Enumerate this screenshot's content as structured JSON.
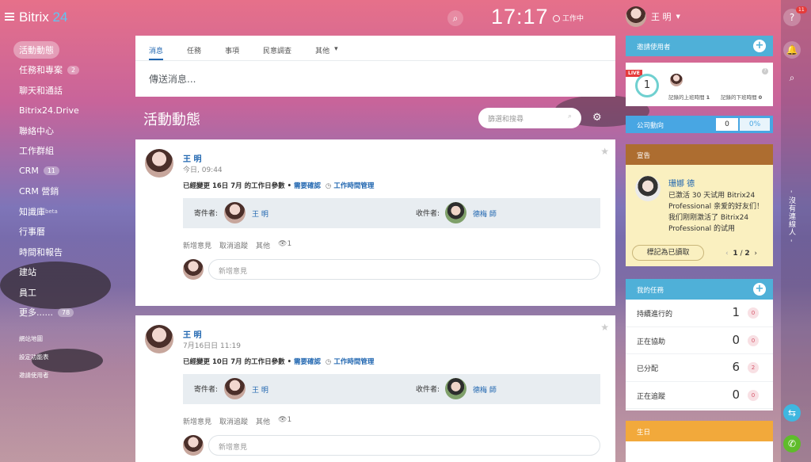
{
  "app": {
    "logo_text": "Bitrix",
    "logo_num": "24"
  },
  "topbar": {
    "clock": "17:17",
    "work_status": "工作中",
    "user_name": "王 明"
  },
  "menu": {
    "items": [
      {
        "label": "活動動態",
        "active": true
      },
      {
        "label": "任務和專案",
        "badge": "2"
      },
      {
        "label": "聊天和通話"
      },
      {
        "label": "Bitrix24.Drive"
      },
      {
        "label": "聯絡中心"
      },
      {
        "label": "工作群組"
      },
      {
        "label": "CRM",
        "badge": "11"
      },
      {
        "label": "CRM 營銷"
      },
      {
        "label": "知識庫",
        "sup": "beta"
      },
      {
        "label": "行事曆"
      },
      {
        "label": "時間和報告"
      },
      {
        "label": "建站"
      },
      {
        "label": "員工"
      },
      {
        "label": "更多......",
        "badge": "78"
      }
    ],
    "small": [
      "網站地圖",
      "設定功能表",
      "邀請使用者"
    ]
  },
  "composer": {
    "tabs": [
      "消息",
      "任務",
      "事項",
      "民意調查",
      "其他"
    ],
    "placeholder": "傳送消息..."
  },
  "stream": {
    "title": "活動動態",
    "filter_placeholder": "篩選和搜尋"
  },
  "posts": [
    {
      "author": "王 明",
      "date": "今日, 09:44",
      "msg_text": "已經變更 16日 7月 的工作日參數 •",
      "msg_link": "需要確認",
      "msg_link2": "工作時間管理",
      "sender_label": "寄件者:",
      "sender": "王 明",
      "receiver_label": "收件者:",
      "receiver": "德梅 師",
      "actions": [
        "新增意見",
        "取消追蹤",
        "其他"
      ],
      "views": "1",
      "comment_placeholder": "新增意見"
    },
    {
      "author": "王 明",
      "date": "7月16日日 11:19",
      "msg_text": "已經變更 10日 7月 的工作日參數 •",
      "msg_link": "需要確認",
      "msg_link2": "工作時間管理",
      "sender_label": "寄件者:",
      "sender": "王 明",
      "receiver_label": "收件者:",
      "receiver": "德梅 師",
      "actions": [
        "新增意見",
        "取消追蹤",
        "其他"
      ],
      "views": "1",
      "comment_placeholder": "新增意見"
    }
  ],
  "right": {
    "invite": "邀請使用者",
    "live": {
      "tag": "LIVE",
      "count": "1",
      "start_label": "記錄的上班時間",
      "start_val": "1",
      "end_label": "記錄的下班時間",
      "end_val": "0"
    },
    "pulse": {
      "label": "公司動向",
      "value": "0",
      "percent": "0%"
    },
    "announcement": {
      "title": "宣告",
      "author": "珊娜 德",
      "text": "已激活 30 天试用 Bitrix24 Professional 亲爱的好友们！ 我们刚刚激活了 Bitrix24 Professional 的试用",
      "button": "標記為已讀取",
      "page": "1",
      "pages": "2"
    },
    "tasks": {
      "title": "我的任務",
      "rows": [
        {
          "label": "持續進行的",
          "count": "1",
          "badge": "0"
        },
        {
          "label": "正在協助",
          "count": "0",
          "badge": "0"
        },
        {
          "label": "已分配",
          "count": "6",
          "badge": "2"
        },
        {
          "label": "正在追蹤",
          "count": "0",
          "badge": "0"
        }
      ]
    },
    "birthday": "生日"
  },
  "sidebar_right": {
    "help_badge": "11",
    "nobody": "- 沒有連線人 -"
  }
}
